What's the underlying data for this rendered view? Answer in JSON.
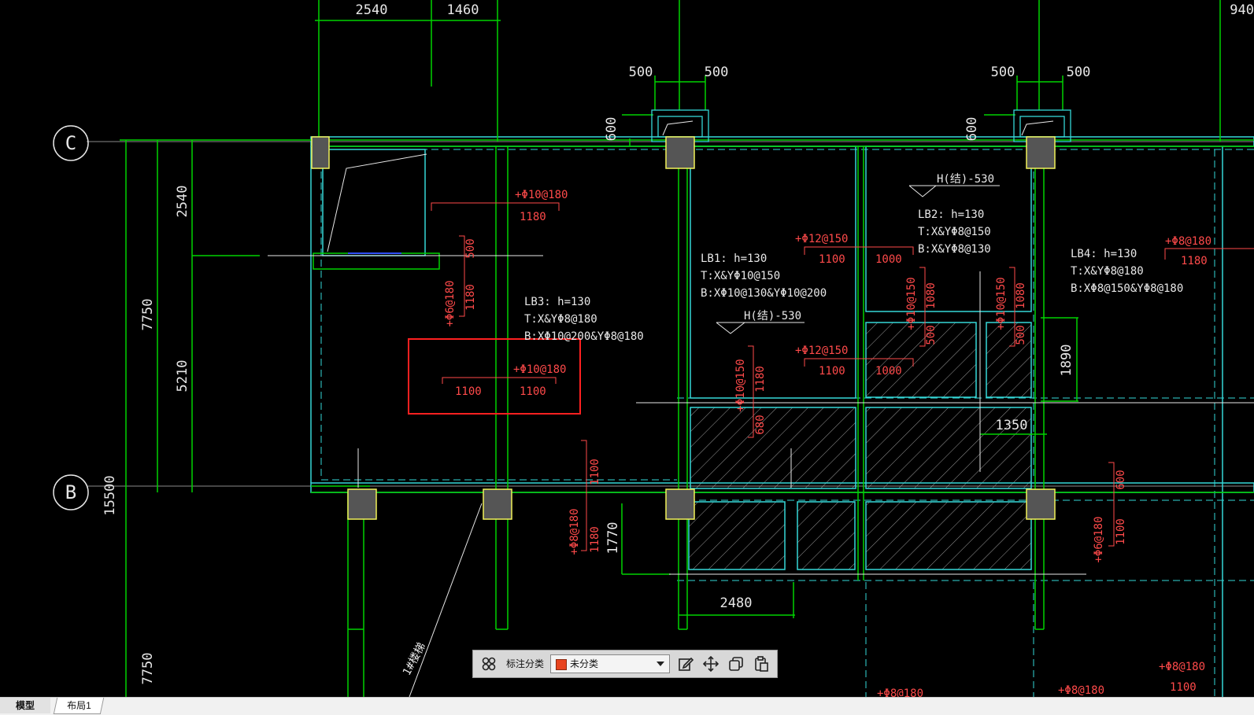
{
  "axes": {
    "c": "C",
    "b": "B"
  },
  "dims": {
    "top_2540": "2540",
    "top_1460": "1460",
    "top_right": "940",
    "col1_500a": "500",
    "col1_500b": "500",
    "col1_600": "600",
    "col2_500a": "500",
    "col2_500b": "500",
    "col2_600": "600",
    "left_2540": "2540",
    "left_5210": "5210",
    "left_7750a": "7750",
    "left_15500": "15500",
    "left_7750b": "7750",
    "d_1890": "1890",
    "d_1350": "1350",
    "d_1770": "1770",
    "d_2480": "2480"
  },
  "slabs": {
    "lb3": {
      "name": "LB3: h=130",
      "top": "T:X&YΦ8@180",
      "bot": "B:XΦ10@200&YΦ8@180"
    },
    "lb1": {
      "name": "LB1: h=130",
      "top": "T:X&YΦ10@150",
      "bot": "B:XΦ10@130&YΦ10@200"
    },
    "lb2": {
      "name": "LB2: h=130",
      "top": "T:X&YΦ8@150",
      "bot": "B:X&YΦ8@130"
    },
    "lb4": {
      "name": "LB4: h=130",
      "top": "T:X&YΦ8@180",
      "bot": "B:XΦ8@150&YΦ8@180"
    }
  },
  "elev": {
    "e1": "H(结)-530",
    "e2": "H(结)-530"
  },
  "rebar": {
    "r1": "+Φ10@180",
    "r1v": "1180",
    "r2": "+Φ6@180",
    "r2a": "500",
    "r2b": "1180",
    "r3": "+Φ10@180",
    "r3a": "1100",
    "r3b": "1100",
    "r4": "+Φ12@150",
    "r4a": "1100",
    "r4b": "1000",
    "r5": "+Φ12@150",
    "r5a": "1100",
    "r5b": "1000",
    "r6": "+Φ10@150",
    "r6a": "1080",
    "r6b": "500",
    "r7": "+Φ10@150",
    "r7a": "1080",
    "r7b": "500",
    "r8": "+Φ8@180",
    "r8a": "1180",
    "r9": "+Φ10@150",
    "r9a": "1180",
    "r9b": "680",
    "r10": "+Φ8@180",
    "r10a": "1180",
    "r10b": "1100",
    "r11": "+Φ6@180",
    "r11a": "600",
    "r11b": "1100",
    "r12": "+Φ8@180",
    "r12a": "1100",
    "r13": "+Φ8@180",
    "r14": "+Φ8@180"
  },
  "stair": "1#楼梯",
  "toolbar": {
    "label": "标注分类",
    "selected": "未分类"
  },
  "tabs": {
    "model": "模型",
    "layout": "布局1"
  },
  "colors": {
    "green": "#00d200",
    "cyan": "#35d7d7",
    "red": "#ff4a4a",
    "yellow": "#f2f25a",
    "white": "#e8e8e8"
  }
}
